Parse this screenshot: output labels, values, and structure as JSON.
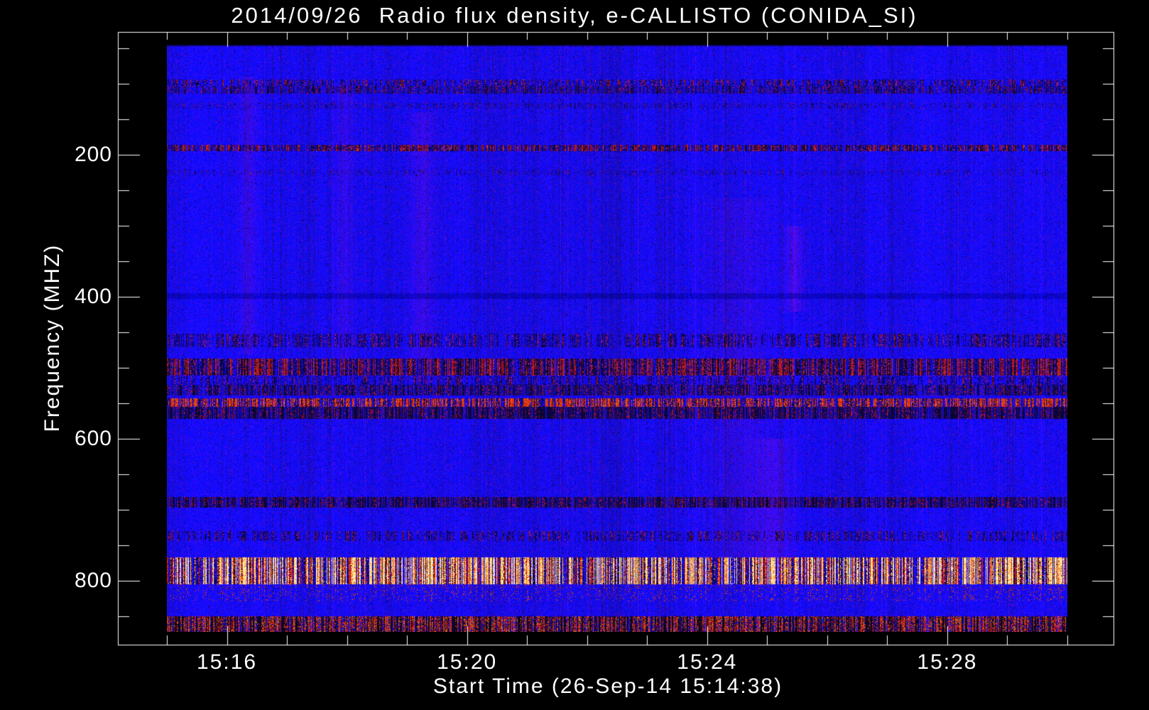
{
  "chart_data": {
    "type": "heatmap",
    "instrument": "e-CALLISTO spectrogram",
    "title": "2014/09/26  Radio flux density, e-CALLISTO (CONIDA_SI)",
    "xlabel": "Start Time (26-Sep-14 15:14:38)",
    "ylabel": "Frequency (MHZ)",
    "x_axis": {
      "unit": "minutes after 15:00",
      "data_start_min": 15.0,
      "data_end_min": 30.0,
      "minor_step_min": 1,
      "major_ticks": [
        {
          "t": 16,
          "label": "15:16"
        },
        {
          "t": 20,
          "label": "15:20"
        },
        {
          "t": 24,
          "label": "15:24"
        },
        {
          "t": 28,
          "label": "15:28"
        }
      ]
    },
    "y_axis": {
      "unit": "MHz",
      "inverted": true,
      "data_top_mhz": 45,
      "data_bottom_mhz": 872,
      "minor_step_mhz": 50,
      "major_ticks": [
        {
          "f": 200,
          "label": "200"
        },
        {
          "f": 400,
          "label": "400"
        },
        {
          "f": 600,
          "label": "600"
        },
        {
          "f": 800,
          "label": "800"
        }
      ]
    },
    "palette": {
      "figure_background": "#000000",
      "quiet_blue": "#1e12e2",
      "purple_speck": "#5a1890",
      "noise_red": "#c81800",
      "noise_orange": "#ff7a00",
      "noise_bright": "#ffe9a0",
      "noise_dark": "#05031e",
      "axis_color": "#ffffff"
    },
    "interference_bands": [
      {
        "f0": 94,
        "f1": 103,
        "type": "red_speckle",
        "strength": 0.55
      },
      {
        "f0": 103,
        "f1": 113,
        "type": "dark_speckle",
        "strength": 0.6
      },
      {
        "f0": 127,
        "f1": 134,
        "type": "dark_speckle",
        "strength": 0.3
      },
      {
        "f0": 186,
        "f1": 194,
        "type": "red_speckle",
        "strength": 0.8
      },
      {
        "f0": 221,
        "f1": 228,
        "type": "dark_speckle",
        "strength": 0.25
      },
      {
        "f0": 395,
        "f1": 402,
        "type": "dark_line",
        "strength": 0.5
      },
      {
        "f0": 452,
        "f1": 470,
        "type": "mixed_speckle",
        "strength": 0.6
      },
      {
        "f0": 487,
        "f1": 510,
        "type": "red_speckle",
        "strength": 0.9
      },
      {
        "f0": 512,
        "f1": 523,
        "type": "mixed_speckle",
        "strength": 0.55
      },
      {
        "f0": 524,
        "f1": 538,
        "type": "dark_speckle",
        "strength": 0.75
      },
      {
        "f0": 543,
        "f1": 555,
        "type": "red_bright",
        "strength": 0.9
      },
      {
        "f0": 555,
        "f1": 571,
        "type": "dark_speckle",
        "strength": 0.9
      },
      {
        "f0": 682,
        "f1": 696,
        "type": "dark_speckle",
        "strength": 0.85
      },
      {
        "f0": 730,
        "f1": 743,
        "type": "mixed_speckle",
        "strength": 0.55
      },
      {
        "f0": 767,
        "f1": 804,
        "type": "bright_band",
        "strength": 1.0
      },
      {
        "f0": 805,
        "f1": 828,
        "type": "red_sparse",
        "strength": 0.5
      },
      {
        "f0": 850,
        "f1": 872,
        "type": "bottom_noise",
        "strength": 1.0
      }
    ],
    "vertical_features": [
      {
        "t": 16.35,
        "width_min": 0.1,
        "strength": 0.3,
        "f0": 90,
        "f1": 480
      },
      {
        "t": 17.95,
        "width_min": 0.1,
        "strength": 0.25,
        "f0": 100,
        "f1": 500
      },
      {
        "t": 19.25,
        "width_min": 0.14,
        "strength": 0.3,
        "f0": 140,
        "f1": 520
      },
      {
        "t": 24.55,
        "width_min": 0.45,
        "strength": 0.18,
        "f0": 260,
        "f1": 780
      },
      {
        "t": 25.45,
        "width_min": 0.1,
        "strength": 0.45,
        "f0": 300,
        "f1": 420
      },
      {
        "t": 25.1,
        "width_min": 0.22,
        "strength": 0.3,
        "f0": 600,
        "f1": 800
      }
    ]
  }
}
